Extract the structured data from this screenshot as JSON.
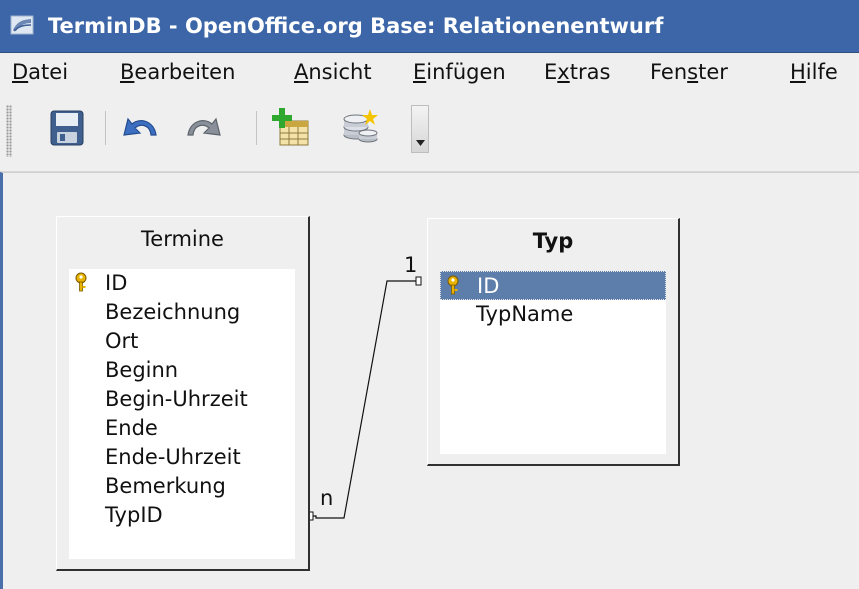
{
  "window": {
    "title": "TerminDB - OpenOffice.org Base: Relationenentwurf",
    "app_icon": "openoffice-base-icon"
  },
  "menu": {
    "items": [
      {
        "name": "menu-datei",
        "accel": "D",
        "rest": "atei"
      },
      {
        "name": "menu-bearbeiten",
        "accel": "B",
        "rest": "earbeiten"
      },
      {
        "name": "menu-ansicht",
        "accel": "A",
        "rest": "nsicht"
      },
      {
        "name": "menu-einfuegen",
        "accel": "E",
        "rest": "infügen"
      },
      {
        "name": "menu-extras",
        "pre": "E",
        "accel": "x",
        "rest": "tras"
      },
      {
        "name": "menu-fenster",
        "pre": "Fen",
        "accel": "s",
        "rest": "ter"
      },
      {
        "name": "menu-hilfe",
        "accel": "H",
        "rest": "ilfe"
      }
    ]
  },
  "toolbar": {
    "buttons": [
      "save-icon",
      "undo-icon",
      "redo-icon",
      "add-table-icon",
      "new-relation-icon"
    ],
    "overflow_icon": "chevron-down-icon"
  },
  "tables": [
    {
      "name": "Termine",
      "bold": false,
      "fields": [
        {
          "name": "ID",
          "primary_key": true,
          "selected": false
        },
        {
          "name": "Bezeichnung",
          "primary_key": false,
          "selected": false
        },
        {
          "name": "Ort",
          "primary_key": false,
          "selected": false
        },
        {
          "name": "Beginn",
          "primary_key": false,
          "selected": false
        },
        {
          "name": "Begin-Uhrzeit",
          "primary_key": false,
          "selected": false
        },
        {
          "name": "Ende",
          "primary_key": false,
          "selected": false
        },
        {
          "name": "Ende-Uhrzeit",
          "primary_key": false,
          "selected": false
        },
        {
          "name": "Bemerkung",
          "primary_key": false,
          "selected": false
        },
        {
          "name": "TypID",
          "primary_key": false,
          "selected": false
        }
      ]
    },
    {
      "name": "Typ",
      "bold": true,
      "fields": [
        {
          "name": "ID",
          "primary_key": true,
          "selected": true
        },
        {
          "name": "TypName",
          "primary_key": false,
          "selected": false
        }
      ]
    }
  ],
  "relation": {
    "from_table": "Termine",
    "from_field": "TypID",
    "from_cardinality": "n",
    "to_table": "Typ",
    "to_field": "ID",
    "to_cardinality": "1"
  },
  "colors": {
    "titlebar": "#3c66a7",
    "selection": "#5d7eab",
    "canvas_edge": "#4a6ea9",
    "key": "#e8b400"
  }
}
